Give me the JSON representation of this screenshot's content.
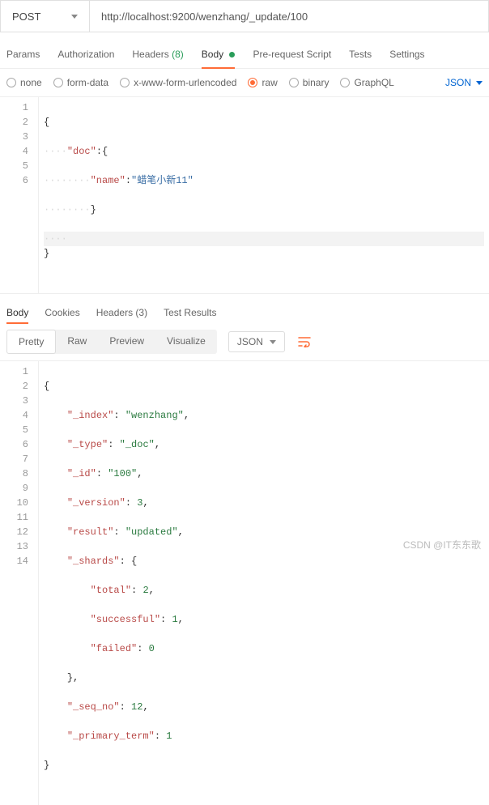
{
  "request": {
    "method": "POST",
    "url": "http://localhost:9200/wenzhang/_update/100"
  },
  "tabs": {
    "params": "Params",
    "authorization": "Authorization",
    "headers": "Headers",
    "headers_count": "(8)",
    "body": "Body",
    "prerequest": "Pre-request Script",
    "tests": "Tests",
    "settings": "Settings"
  },
  "body_types": {
    "none": "none",
    "formdata": "form-data",
    "urlencoded": "x-www-form-urlencoded",
    "raw": "raw",
    "binary": "binary",
    "graphql": "GraphQL",
    "lang": "JSON"
  },
  "request_body": {
    "lines": [
      "1",
      "2",
      "3",
      "4",
      "5",
      "6"
    ],
    "l1": "{",
    "l2_ws": "····",
    "l2_key": "\"doc\"",
    "l2_rest": ":{",
    "l3_ws": "········",
    "l3_key": "\"name\"",
    "l3_colon": ":",
    "l3_val": "\"蜡笔小新11\"",
    "l4_ws": "········",
    "l4": "}",
    "l5_ws": "····",
    "l6": "}"
  },
  "response_tabs": {
    "body": "Body",
    "cookies": "Cookies",
    "headers": "Headers",
    "headers_count": "(3)",
    "tests": "Test Results"
  },
  "view": {
    "pretty": "Pretty",
    "raw": "Raw",
    "preview": "Preview",
    "visualize": "Visualize",
    "type": "JSON"
  },
  "response_body": {
    "lines": [
      "1",
      "2",
      "3",
      "4",
      "5",
      "6",
      "7",
      "8",
      "9",
      "10",
      "11",
      "12",
      "13",
      "14"
    ],
    "keys": {
      "index": "\"_index\"",
      "type": "\"_type\"",
      "id": "\"_id\"",
      "version": "\"_version\"",
      "result": "\"result\"",
      "shards": "\"_shards\"",
      "total": "\"total\"",
      "successful": "\"successful\"",
      "failed": "\"failed\"",
      "seqno": "\"_seq_no\"",
      "primary": "\"_primary_term\""
    },
    "vals": {
      "index": "\"wenzhang\"",
      "type": "\"_doc\"",
      "id": "\"100\"",
      "version": "3",
      "result": "\"updated\"",
      "total": "2",
      "successful": "1",
      "failed": "0",
      "seqno": "12",
      "primary": "1"
    }
  },
  "watermark": "CSDN @IT东东歌"
}
